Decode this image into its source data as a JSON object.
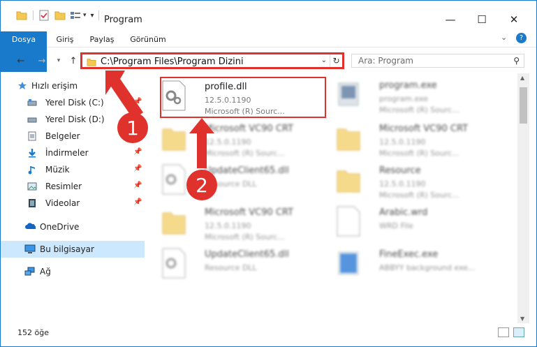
{
  "window": {
    "title": "Program",
    "controls": {
      "minimize": "—",
      "maximize": "☐",
      "close": "✕"
    }
  },
  "ribbon": {
    "tabs": [
      "Dosya",
      "Giriş",
      "Paylaş",
      "Görünüm"
    ],
    "help": "?"
  },
  "nav": {
    "address": "C:\\Program Files\\Program Dizini",
    "search_placeholder": "Ara: Program"
  },
  "sidebar": {
    "items": [
      {
        "label": "Hızlı erişim",
        "icon": "star-icon"
      },
      {
        "label": "Yerel Disk (C:)",
        "icon": "drive-icon"
      },
      {
        "label": "Yerel Disk (D:)",
        "icon": "drive-icon"
      },
      {
        "label": "Belgeler",
        "icon": "document-icon"
      },
      {
        "label": "İndirmeler",
        "icon": "download-icon"
      },
      {
        "label": "Müzik",
        "icon": "music-icon"
      },
      {
        "label": "Resimler",
        "icon": "image-icon"
      },
      {
        "label": "Videolar",
        "icon": "film-icon"
      },
      {
        "label": "OneDrive",
        "icon": "cloud-icon"
      },
      {
        "label": "Bu bilgisayar",
        "icon": "computer-icon"
      },
      {
        "label": "Ağ",
        "icon": "network-icon"
      }
    ]
  },
  "files": [
    {
      "name": "profile.dll",
      "meta1": "12.5.0.1190",
      "meta2": "Microsoft (R) Sourc...",
      "type": "dll"
    },
    {
      "name": "program.exe",
      "meta1": "program.exe",
      "meta2": "Microsoft (R) Sourc...",
      "type": "exe"
    },
    {
      "name": "Microsoft VC90 CRT",
      "meta1": "12.5.0.1190",
      "meta2": "Microsoft (R) Sourc...",
      "type": "folder"
    },
    {
      "name": "Microsoft VC90 CRT",
      "meta1": "12.5.0.1190",
      "meta2": "Microsoft (R) Sourc...",
      "type": "folder"
    },
    {
      "name": "UpdateClient65.dll",
      "meta1": "Resource DLL",
      "meta2": "",
      "type": "dll"
    },
    {
      "name": "Resource",
      "meta1": "12.5.0.1190",
      "meta2": "Microsoft (R) Sourc...",
      "type": "folder"
    },
    {
      "name": "Microsoft VC90 CRT",
      "meta1": "12.5.0.1190",
      "meta2": "Microsoft (R) Sourc...",
      "type": "folder"
    },
    {
      "name": "Arabic.wrd",
      "meta1": "WRD File",
      "meta2": "",
      "type": "doc"
    },
    {
      "name": "UpdateClient65.dll",
      "meta1": "Resource DLL",
      "meta2": "",
      "type": "dll"
    },
    {
      "name": "FineExec.exe",
      "meta1": "ABBYY background exe...",
      "meta2": "",
      "type": "exe"
    }
  ],
  "status": {
    "count": "152 öğe"
  },
  "annotations": {
    "step1": "1",
    "step2": "2"
  }
}
